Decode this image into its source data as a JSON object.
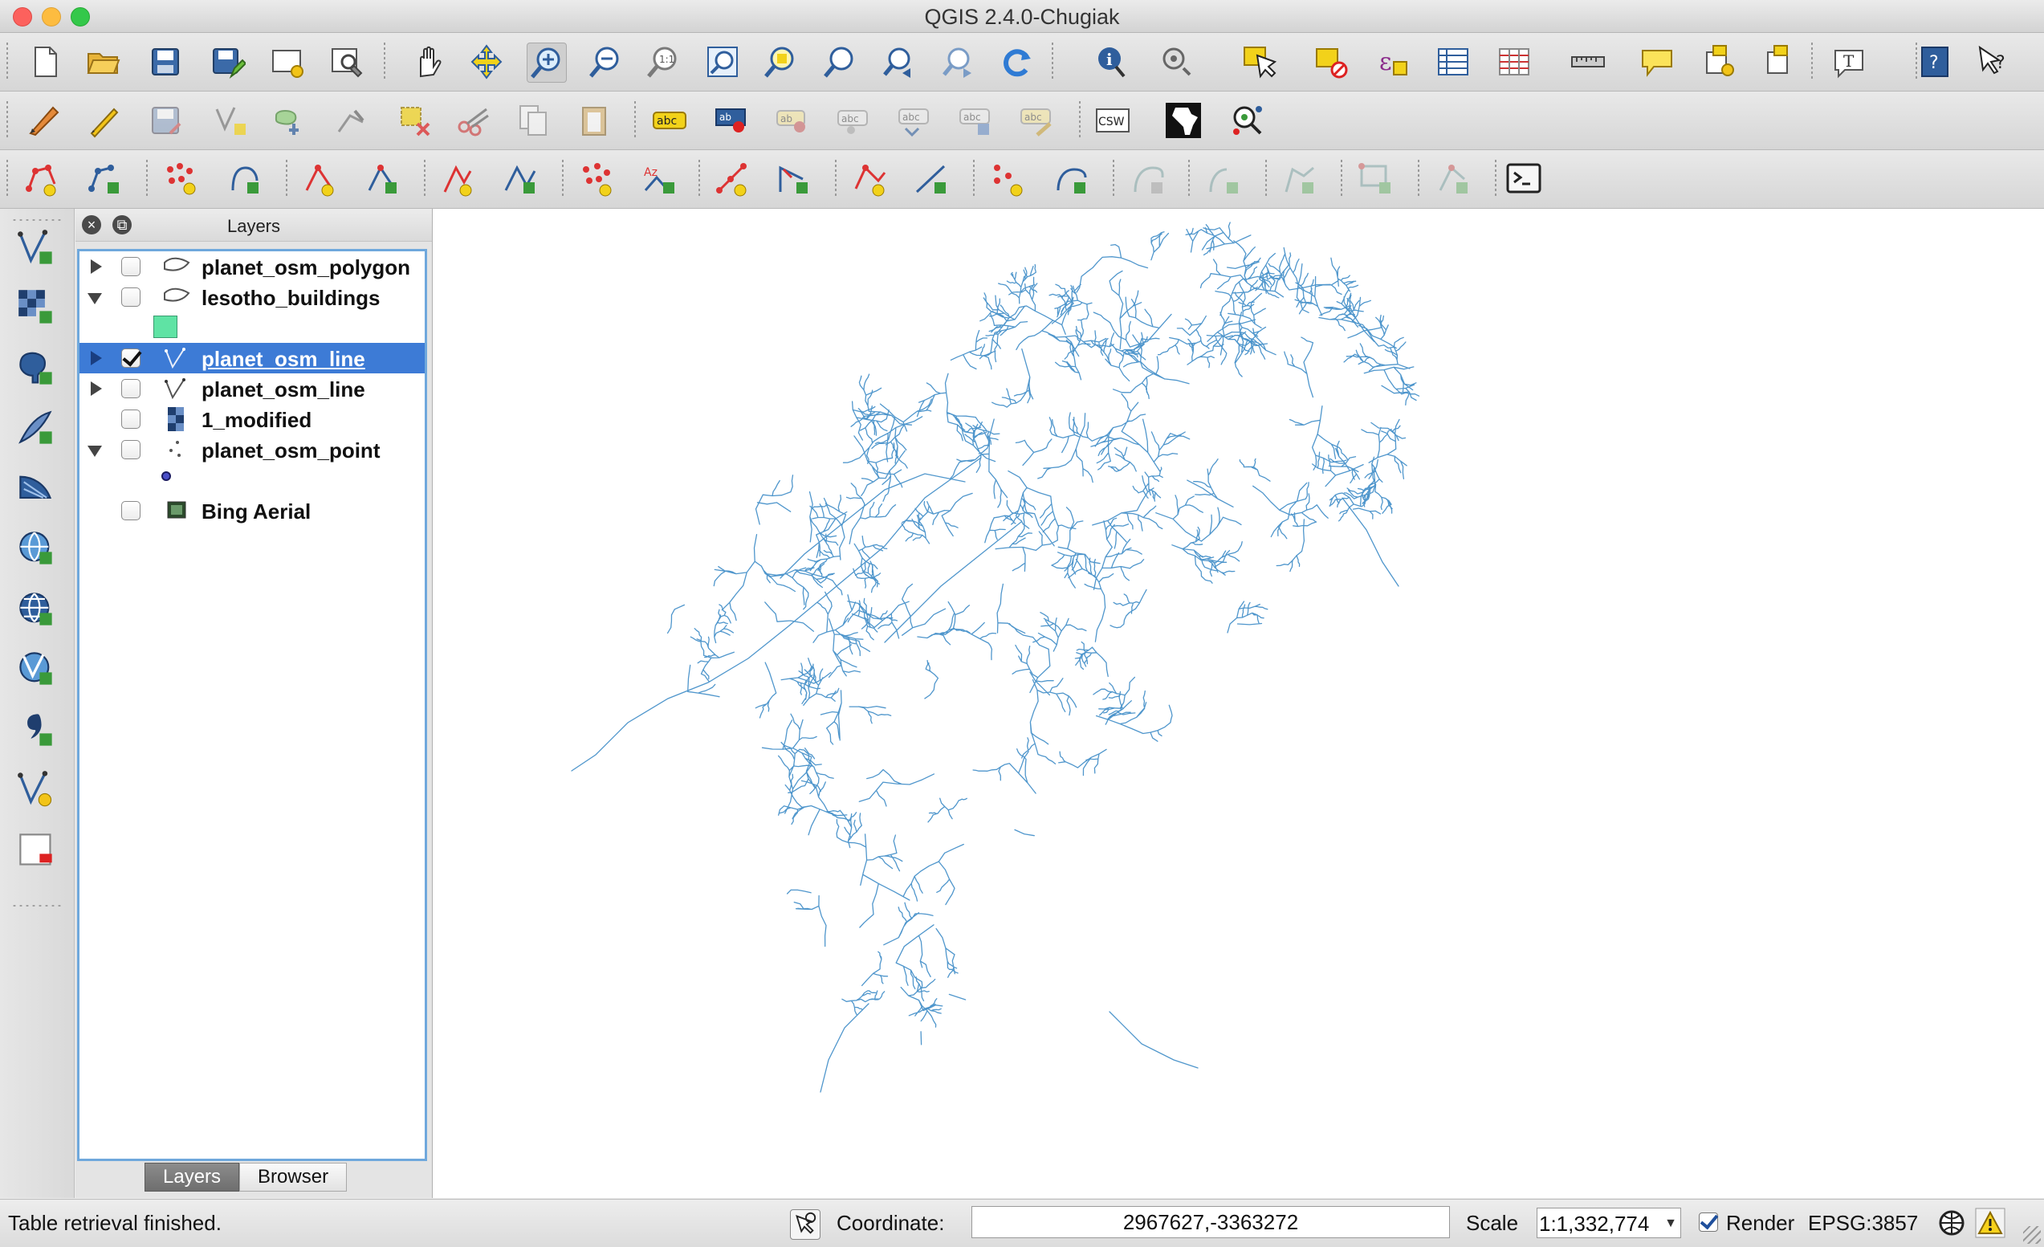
{
  "window": {
    "title": "QGIS 2.4.0-Chugiak"
  },
  "colors": {
    "map_lines": "#4f96cc",
    "selection": "#3d7bd6",
    "building_fill": "#5fe3a4",
    "point_fill": "#4a4fc8"
  },
  "toolbars": {
    "file_nav": [
      "new-project",
      "open-project",
      "save-project",
      "save-as",
      "new-print-composer",
      "composer-manager",
      "pan",
      "pan-to-selection",
      "zoom-in",
      "zoom-out",
      "zoom-actual",
      "zoom-full",
      "zoom-to-selection",
      "zoom-to-layer",
      "zoom-last",
      "zoom-next",
      "refresh",
      "identify",
      "actions",
      "select",
      "deselect",
      "field-calculator",
      "attribute-table",
      "statistics",
      "measure",
      "map-tips",
      "new-bookmark",
      "show-bookmarks",
      "text-annotation",
      "help",
      "whats-this"
    ],
    "editing": [
      "current-edits",
      "toggle-editing",
      "save-edits",
      "add-feature",
      "move-feature",
      "node-tool",
      "delete-selected",
      "cut-features",
      "copy-features",
      "paste-features",
      "label",
      "pin-labels",
      "show-hide-labels",
      "move-label",
      "rotate-label",
      "change-label",
      "csw",
      "africa-plugin",
      "geo-search"
    ],
    "digitizing": [
      "add-ring",
      "add-part",
      "fill-ring",
      "delete-ring",
      "delete-part",
      "reshape",
      "offset-curve",
      "split-features",
      "split-parts",
      "merge-selected",
      "merge-attributes",
      "rotate-point-symbols",
      "simplify",
      "rotate-feature",
      "add-circular-string",
      "fill-feature",
      "node-tool-adv",
      "move-node",
      "reverse-line",
      "snap-nodes",
      "topology",
      "python-console"
    ]
  },
  "left_toolbar": [
    "add-vector-layer",
    "add-raster-layer",
    "add-postgis-layer",
    "add-spatialite-layer",
    "add-mssql-layer",
    "add-wms-layer",
    "add-wcs-layer",
    "add-wfs-layer",
    "add-delimited-text-layer",
    "new-shapefile-layer",
    "remove-layer"
  ],
  "layers_panel": {
    "title": "Layers",
    "layers": [
      {
        "name": "planet_osm_polygon",
        "checked": false,
        "expanded": false,
        "type": "polygon",
        "selected": false
      },
      {
        "name": "lesotho_buildings",
        "checked": false,
        "expanded": true,
        "type": "polygon",
        "selected": false
      },
      {
        "name": "planet_osm_line",
        "checked": true,
        "expanded": false,
        "type": "line",
        "selected": true
      },
      {
        "name": "planet_osm_line",
        "checked": false,
        "expanded": false,
        "type": "line",
        "selected": false
      },
      {
        "name": "1_modified",
        "checked": false,
        "expanded": null,
        "type": "raster",
        "selected": false
      },
      {
        "name": "planet_osm_point",
        "checked": false,
        "expanded": true,
        "type": "point",
        "selected": false
      },
      {
        "name": "Bing Aerial",
        "checked": false,
        "expanded": null,
        "type": "wms",
        "selected": false
      }
    ],
    "tabs": [
      {
        "label": "Layers",
        "active": true
      },
      {
        "label": "Browser",
        "active": false
      }
    ]
  },
  "statusbar": {
    "message": "Table retrieval finished.",
    "coordinate_label": "Coordinate:",
    "coordinate_value": "2967627,-3363272",
    "scale_label": "Scale",
    "scale_value": "1:1,332,774",
    "render_label": "Render",
    "render_checked": true,
    "crs": "EPSG:3857"
  }
}
